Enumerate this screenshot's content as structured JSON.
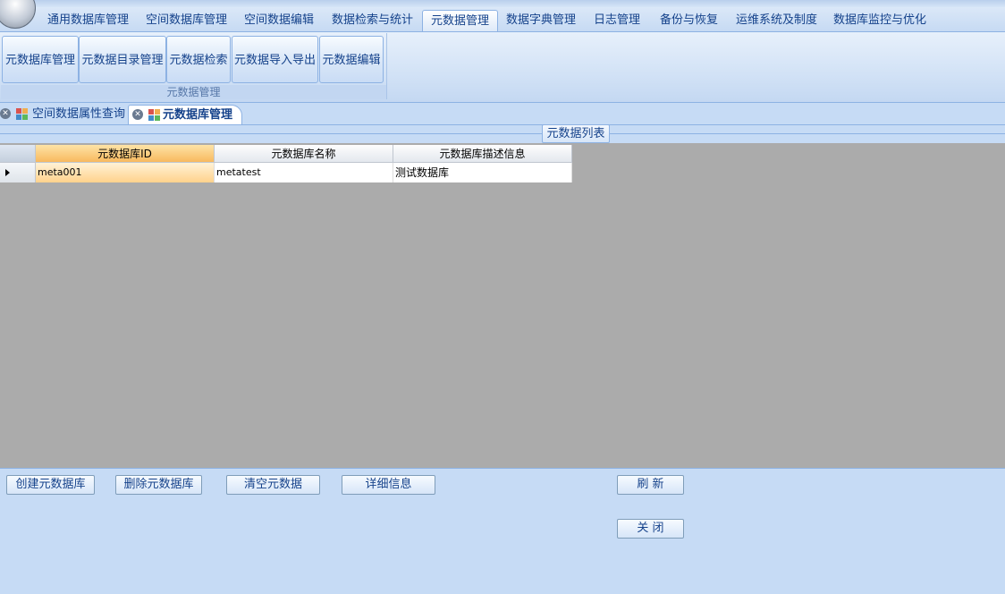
{
  "menubar": {
    "tabs": [
      {
        "label": "通用数据库管理"
      },
      {
        "label": "空间数据库管理"
      },
      {
        "label": "空间数据编辑"
      },
      {
        "label": "数据检索与统计"
      },
      {
        "label": "元数据管理"
      },
      {
        "label": "数据字典管理"
      },
      {
        "label": "日志管理"
      },
      {
        "label": "备份与恢复"
      },
      {
        "label": "运维系统及制度"
      },
      {
        "label": "数据库监控与优化"
      }
    ],
    "active": "元数据管理"
  },
  "ribbon": {
    "group_label": "元数据管理",
    "buttons": [
      {
        "label": "元数据库管理"
      },
      {
        "label": "元数据目录管理"
      },
      {
        "label": "元数据检索"
      },
      {
        "label": "元数据导入导出"
      },
      {
        "label": "元数据编辑"
      }
    ]
  },
  "doc_tabs": [
    {
      "label": "空间数据属性查询",
      "icon": "grid-icon",
      "active": false
    },
    {
      "label": "元数据库管理",
      "icon": "grid-icon",
      "active": true
    }
  ],
  "list_section": {
    "label": "元数据列表"
  },
  "table": {
    "columns": [
      "元数据库ID",
      "元数据库名称",
      "元数据库描述信息"
    ],
    "rows": [
      [
        "meta001",
        "metatest",
        "测试数据库"
      ]
    ]
  },
  "actions": {
    "create": "创建元数据库",
    "delete": "删除元数据库",
    "clear": "清空元数据",
    "details": "详细信息",
    "refresh": "刷  新",
    "close": "关  闭"
  },
  "colors": {
    "panel_bg": "#c6dbf5",
    "border": "#8db2e3",
    "text": "#15428b",
    "grid_bg": "#ababab",
    "selected_header": "#f8b95e"
  }
}
